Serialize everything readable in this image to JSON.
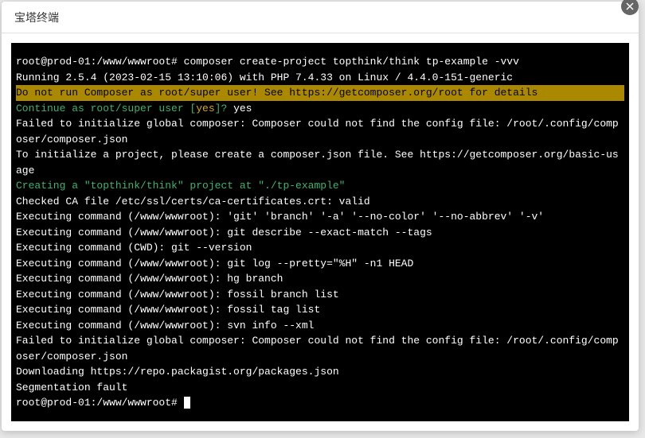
{
  "window": {
    "title": "宝塔终端"
  },
  "terminal": {
    "prompt1": "root@prod-01:/www/wwwroot#",
    "command1": " composer create-project topthink/think tp-example -vvv",
    "line2": "Running 2.5.4 (2023-02-15 13:10:06) with PHP 7.4.33 on Linux / 4.4.0-151-generic",
    "warn": "Do not run Composer as root/super user! See https://getcomposer.org/root for details",
    "continue_prompt": "Continue as root/super user ",
    "continue_bracket_open": "[",
    "continue_yes": "yes",
    "continue_bracket_close": "]? ",
    "continue_answer": "yes",
    "line5": "Failed to initialize global composer: Composer could not find the config file: /root/.config/composer/composer.json",
    "line6": "To initialize a project, please create a composer.json file. See https://getcomposer.org/basic-usage",
    "creating": "Creating a \"topthink/think\" project at \"./tp-example\"",
    "line8": "Checked CA file /etc/ssl/certs/ca-certificates.crt: valid",
    "line9": "Executing command (/www/wwwroot): 'git' 'branch' '-a' '--no-color' '--no-abbrev' '-v'",
    "line10": "Executing command (/www/wwwroot): git describe --exact-match --tags",
    "line11": "Executing command (CWD): git --version",
    "line12": "Executing command (/www/wwwroot): git log --pretty=\"%H\" -n1 HEAD",
    "line13": "Executing command (/www/wwwroot): hg branch",
    "line14": "Executing command (/www/wwwroot): fossil branch list",
    "line15": "Executing command (/www/wwwroot): fossil tag list",
    "line16": "Executing command (/www/wwwroot): svn info --xml",
    "line17": "Failed to initialize global composer: Composer could not find the config file: /root/.config/composer/composer.json",
    "blank": "",
    "line18": "Downloading https://repo.packagist.org/packages.json",
    "line19": "Segmentation fault",
    "prompt2": "root@prod-01:/www/wwwroot# "
  }
}
